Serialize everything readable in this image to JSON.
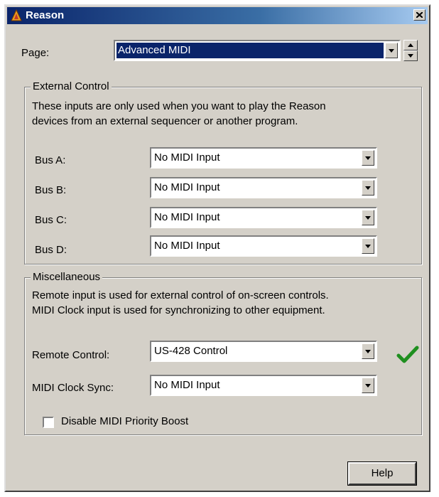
{
  "window": {
    "title": "Reason",
    "close_glyph": "close-icon"
  },
  "page": {
    "label": "Page:",
    "value": "Advanced MIDI"
  },
  "external_control": {
    "title": "External Control",
    "description_line1": "These inputs are only used when you want to play the Reason",
    "description_line2": "devices from an external sequencer or another program.",
    "buses": [
      {
        "label": "Bus A:",
        "value": "No MIDI Input"
      },
      {
        "label": "Bus B:",
        "value": "No MIDI Input"
      },
      {
        "label": "Bus C:",
        "value": "No MIDI Input"
      },
      {
        "label": "Bus D:",
        "value": "No MIDI Input"
      }
    ]
  },
  "misc": {
    "title": "Miscellaneous",
    "description_line1": "Remote input is used for external control of on-screen controls.",
    "description_line2": "MIDI Clock input is used for synchronizing to other equipment.",
    "remote_control": {
      "label": "Remote Control:",
      "value": "US-428 Control"
    },
    "midi_clock_sync": {
      "label": "MIDI Clock Sync:",
      "value": "No MIDI Input"
    },
    "disable_priority_boost": {
      "label": "Disable MIDI Priority Boost",
      "checked": false
    }
  },
  "buttons": {
    "help": "Help"
  },
  "colors": {
    "title_bar": "#0a246a",
    "dialog_bg": "#d4d0c8",
    "selection": "#0a246a",
    "check_green": "#1f8f1f"
  }
}
